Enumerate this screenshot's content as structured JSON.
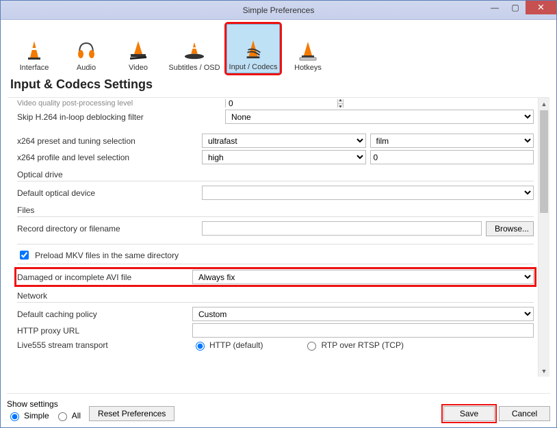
{
  "window": {
    "title": "Simple Preferences",
    "minimize": "—",
    "maximize": "▢",
    "close": "✕"
  },
  "categories": [
    {
      "label": "Interface"
    },
    {
      "label": "Audio"
    },
    {
      "label": "Video"
    },
    {
      "label": "Subtitles / OSD"
    },
    {
      "label": "Input / Codecs",
      "selected": true
    },
    {
      "label": "Hotkeys"
    }
  ],
  "heading": "Input & Codecs Settings",
  "cutoff": "Video quality post-processing level",
  "cutoff_value": "0",
  "fields": {
    "skip_h264_label": "Skip H.264 in-loop deblocking filter",
    "skip_h264_value": "None",
    "x264_preset_label": "x264 preset and tuning selection",
    "x264_preset_value": "ultrafast",
    "x264_tuning_value": "film",
    "x264_profile_label": "x264 profile and level selection",
    "x264_profile_value": "high",
    "x264_level_value": "0",
    "optical_group": "Optical drive",
    "optical_label": "Default optical device",
    "files_group": "Files",
    "record_label": "Record directory or filename",
    "browse_btn": "Browse...",
    "preload_mkv": "Preload MKV files in the same directory",
    "avi_label": "Damaged or incomplete AVI file",
    "avi_value": "Always fix",
    "network_group": "Network",
    "caching_label": "Default caching policy",
    "caching_value": "Custom",
    "http_proxy_label": "HTTP proxy URL",
    "live555_label": "Live555 stream transport",
    "live555_http": "HTTP (default)",
    "live555_rtp": "RTP over RTSP (TCP)"
  },
  "footer": {
    "show_settings": "Show settings",
    "simple": "Simple",
    "all": "All",
    "reset": "Reset Preferences",
    "save": "Save",
    "cancel": "Cancel"
  }
}
